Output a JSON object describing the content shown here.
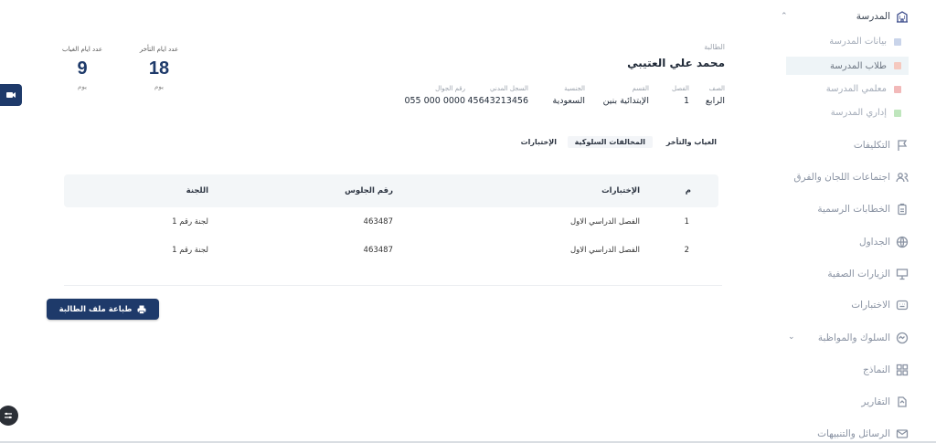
{
  "sidebar": {
    "school": "المدرسة",
    "sub_items": [
      {
        "label": "بيانات المدرسة",
        "color": "#c9d4ea"
      },
      {
        "label": "طلاب المدرسة",
        "color": "#f5c9bf"
      },
      {
        "label": "معلمي المدرسة",
        "color": "#f2b9b9"
      },
      {
        "label": "إداري المدرسة",
        "color": "#bfe6bd"
      }
    ],
    "items": [
      {
        "label": "التكليفات"
      },
      {
        "label": "اجتماعات اللجان والفرق"
      },
      {
        "label": "الخطابات الرسمية"
      },
      {
        "label": "الجداول"
      },
      {
        "label": "الزيارات الصفية"
      },
      {
        "label": "الاختبارات"
      },
      {
        "label": "السلوك والمواظبة"
      },
      {
        "label": "النماذج"
      },
      {
        "label": "التقارير"
      },
      {
        "label": "الرسائل والتنبيهات"
      }
    ]
  },
  "stats": {
    "late_label": "عدد ايام التأخر",
    "late_value": "18",
    "late_unit": "يوم",
    "absence_label": "عدد ايام الغياب",
    "absence_value": "9",
    "absence_unit": "يوم"
  },
  "student": {
    "label": "الطالبة",
    "name": "محمد علي العتيبي",
    "fields": [
      {
        "key": "الصف",
        "value": "الرابع"
      },
      {
        "key": "الفصل",
        "value": "1"
      },
      {
        "key": "القسم",
        "value": "الإبتدائية بنين"
      },
      {
        "key": "الجنسية",
        "value": "السعودية"
      },
      {
        "key": "السجل المدني",
        "value": "45643213456"
      },
      {
        "key": "رقم الجوال",
        "value": "0000 000 055"
      }
    ]
  },
  "tabs": {
    "absence": "الغياب والتأخر",
    "violations": "المخالفات السلوكية",
    "exams": "الإختبارات"
  },
  "table": {
    "headers": {
      "m": "م",
      "exam": "الإختبارات",
      "seat": "رقم الجلوس",
      "committee": "اللجنة"
    },
    "rows": [
      {
        "m": "1",
        "exam": "الفصل الدراسي الاول",
        "seat": "463487",
        "committee": "لجنة رقم 1"
      },
      {
        "m": "2",
        "exam": "الفصل الدراسي الاول",
        "seat": "463487",
        "committee": "لجنة رقم 1"
      }
    ]
  },
  "print_button": "طباعة ملف الطالبة"
}
